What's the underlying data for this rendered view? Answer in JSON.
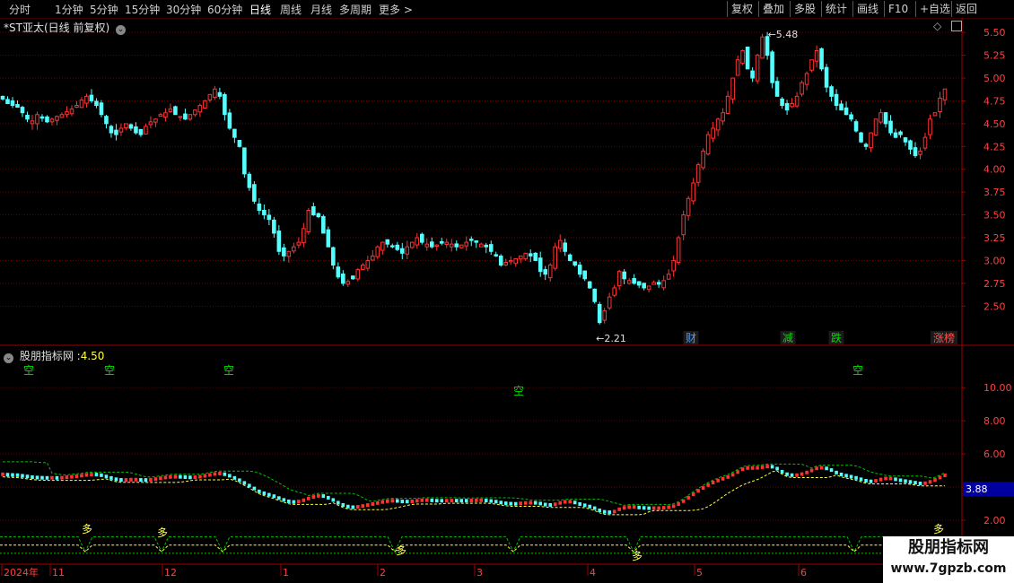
{
  "toolbar": {
    "tabs": [
      "分时",
      "1分钟",
      "5分钟",
      "15分钟",
      "30分钟",
      "60分钟",
      "日线",
      "周线",
      "月线",
      "多周期",
      "更多 >"
    ],
    "active": "日线",
    "right_buttons": [
      "复权",
      "叠加",
      "多股",
      "统计",
      "画线",
      "F10",
      "+自选",
      "返回"
    ]
  },
  "main_header": {
    "title": "*ST亚太(日线 前复权)"
  },
  "indicator_header": {
    "title": "股朋指标网",
    "value": ":4.50"
  },
  "colors": {
    "up": "#ff3232",
    "down": "#54ffff",
    "axis": "#a00000",
    "grid": "#6a0000",
    "ma_green": "#00c000",
    "ma_yellow": "#ffff40"
  },
  "chart_data": {
    "type": "candlestick",
    "price_axis": {
      "ticks": [
        "5.50",
        "5.25",
        "5.00",
        "4.75",
        "4.50",
        "4.25",
        "4.00",
        "3.75",
        "3.50",
        "3.25",
        "3.00",
        "2.75",
        "2.50"
      ],
      "range": [
        2.1,
        5.6
      ]
    },
    "indicator_axis": {
      "ticks": [
        "10.00",
        "8.00",
        "6.00",
        "4.00",
        "2.00",
        "0.00"
      ],
      "range": [
        -0.6,
        12.5
      ],
      "current": "3.88"
    },
    "x_axis_labels": [
      "2024年",
      "11",
      "12",
      "1",
      "2",
      "3",
      "4",
      "5",
      "6"
    ],
    "annotations": {
      "high": "5.48",
      "low": "2.21"
    },
    "events": [
      "财",
      "减",
      "跌",
      "涨榜"
    ],
    "signals_short": [
      "空",
      "空",
      "空",
      "空",
      "空"
    ],
    "signals_long": [
      "多",
      "多",
      "多",
      "多",
      "多"
    ],
    "price": [
      4.77,
      4.72,
      4.7,
      4.68,
      4.62,
      4.55,
      4.53,
      4.6,
      4.56,
      4.52,
      4.55,
      4.58,
      4.6,
      4.63,
      4.66,
      4.7,
      4.76,
      4.8,
      4.75,
      4.7,
      4.6,
      4.5,
      4.4,
      4.38,
      4.45,
      4.5,
      4.45,
      4.4,
      4.38,
      4.47,
      4.52,
      4.55,
      4.6,
      4.62,
      4.66,
      4.6,
      4.58,
      4.55,
      4.6,
      4.65,
      4.7,
      4.75,
      4.82,
      4.88,
      4.8,
      4.6,
      4.45,
      4.35,
      4.25,
      3.95,
      3.8,
      3.65,
      3.55,
      3.5,
      3.45,
      3.3,
      3.1,
      3.05,
      3.1,
      3.15,
      3.2,
      3.35,
      3.55,
      3.5,
      3.48,
      3.3,
      3.15,
      2.95,
      2.82,
      2.75,
      2.77,
      2.8,
      2.9,
      2.95,
      3.0,
      3.05,
      3.15,
      3.2,
      3.18,
      3.15,
      3.12,
      3.08,
      3.15,
      3.2,
      3.25,
      3.2,
      3.18,
      3.15,
      3.17,
      3.19,
      3.2,
      3.18,
      3.15,
      3.17,
      3.2,
      3.22,
      3.2,
      3.18,
      3.15,
      3.1,
      3.05,
      2.95,
      2.98,
      3.0,
      3.02,
      3.05,
      3.08,
      3.05,
      3.0,
      2.88,
      2.85,
      2.95,
      3.15,
      3.22,
      3.1,
      3.0,
      2.95,
      2.85,
      2.8,
      2.7,
      2.55,
      2.32,
      2.45,
      2.6,
      2.7,
      2.88,
      2.8,
      2.78,
      2.75,
      2.73,
      2.7,
      2.72,
      2.76,
      2.74,
      2.78,
      2.85,
      3.0,
      3.25,
      3.5,
      3.68,
      3.85,
      4.05,
      4.2,
      4.38,
      4.45,
      4.55,
      4.62,
      4.8,
      5.0,
      5.2,
      5.3,
      5.1,
      5.0,
      5.25,
      5.45,
      5.25,
      4.95,
      4.8,
      4.7,
      4.65,
      4.72,
      4.8,
      4.95,
      5.05,
      5.2,
      5.3,
      5.1,
      4.9,
      4.8,
      4.7,
      4.65,
      4.6,
      4.55,
      4.42,
      4.3,
      4.25,
      4.4,
      4.55,
      4.62,
      4.5,
      4.4,
      4.35,
      4.38,
      4.3,
      4.22,
      4.15,
      4.2,
      4.35,
      4.55,
      4.62,
      4.78,
      4.88
    ]
  }
}
